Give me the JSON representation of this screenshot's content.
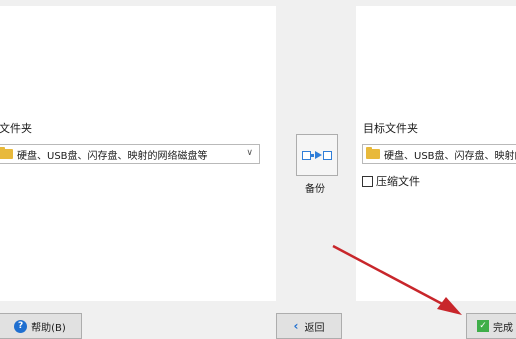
{
  "source": {
    "label": "源文件夹",
    "combo_value": "硬盘、USB盘、闪存盘、映射的网络磁盘等"
  },
  "backup": {
    "label": "备份"
  },
  "target": {
    "label": "目标文件夹",
    "combo_value": "硬盘、USB盘、闪存盘、映射的",
    "compress_label": "压缩文件"
  },
  "buttons": {
    "help": "帮助(B)",
    "back": "返回",
    "done": "完成"
  },
  "icons": {
    "help": "question-icon",
    "back": "back-arrow-icon",
    "done": "checkmark-icon",
    "folder": "folder-icon",
    "backup": "backup-transfer-icon"
  },
  "colors": {
    "accent": "#2f7ed8",
    "folder": "#e8b93b",
    "done": "#3fae49"
  }
}
